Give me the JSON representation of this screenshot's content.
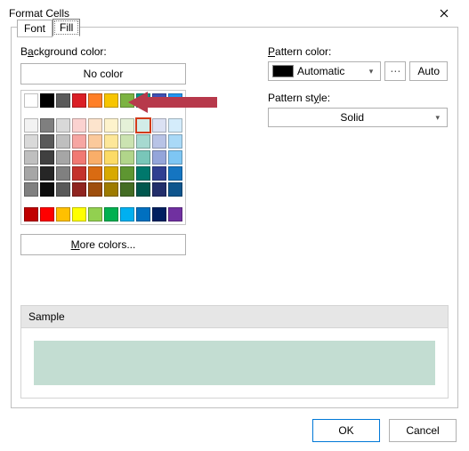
{
  "window": {
    "title": "Format Cells"
  },
  "tabs": {
    "font": "Font",
    "fill": "Fill"
  },
  "left": {
    "bg_label_pre": "B",
    "bg_label_u": "a",
    "bg_label_post": "ckground color:",
    "no_color": "No color",
    "more_pre": "",
    "more_u": "M",
    "more_post": "ore colors..."
  },
  "right": {
    "pc_pre": "",
    "pc_u": "P",
    "pc_post": "attern color:",
    "pattern_color_value": "Automatic",
    "auto_btn": "Auto",
    "ps_pre": "Pattern st",
    "ps_u": "y",
    "ps_post": "le:",
    "pattern_style_value": "Solid"
  },
  "sample": {
    "label": "Sample",
    "color": "#c3ddd2"
  },
  "footer": {
    "ok": "OK",
    "cancel": "Cancel"
  },
  "palette": {
    "row0": [
      "#ffffff",
      "#000000",
      "#5b5b5b",
      "#da1f26",
      "#ff7f27",
      "#f7c500",
      "#7cb342",
      "#009688",
      "#3f51b5",
      "#2196f3"
    ],
    "tints": [
      [
        "#f2f2f2",
        "#7f7f7f",
        "#d9d9d9",
        "#fbd2d0",
        "#fde4cd",
        "#fef3cc",
        "#e5f1d8",
        "#d2ece8",
        "#dbe1f3",
        "#d4ecfb"
      ],
      [
        "#d9d9d9",
        "#595959",
        "#bfbfbf",
        "#f6a6a2",
        "#fbc99b",
        "#fde799",
        "#cbe3b1",
        "#a6d9d0",
        "#b8c3e6",
        "#a9d9f7"
      ],
      [
        "#bfbfbf",
        "#404040",
        "#a6a6a6",
        "#f17973",
        "#f9ae69",
        "#fcdb66",
        "#b1d58a",
        "#79c6b9",
        "#94a5da",
        "#7ec6f3"
      ],
      [
        "#a6a6a6",
        "#262626",
        "#808080",
        "#c4322b",
        "#d96b12",
        "#d8a900",
        "#5e9631",
        "#00786c",
        "#2f3f91",
        "#1575c1"
      ],
      [
        "#808080",
        "#0d0d0d",
        "#595959",
        "#8f241f",
        "#9e4e0d",
        "#9e7b00",
        "#446d24",
        "#00574e",
        "#222e6a",
        "#0f558d"
      ]
    ],
    "standard": [
      "#c00000",
      "#ff0000",
      "#ffc000",
      "#ffff00",
      "#92d050",
      "#00b050",
      "#00b0f0",
      "#0070c0",
      "#002060",
      "#7030a0"
    ],
    "selected": {
      "section": "tints",
      "row": 0,
      "col": 7
    }
  },
  "chart_data": {
    "type": "table",
    "note": "not a chart"
  }
}
